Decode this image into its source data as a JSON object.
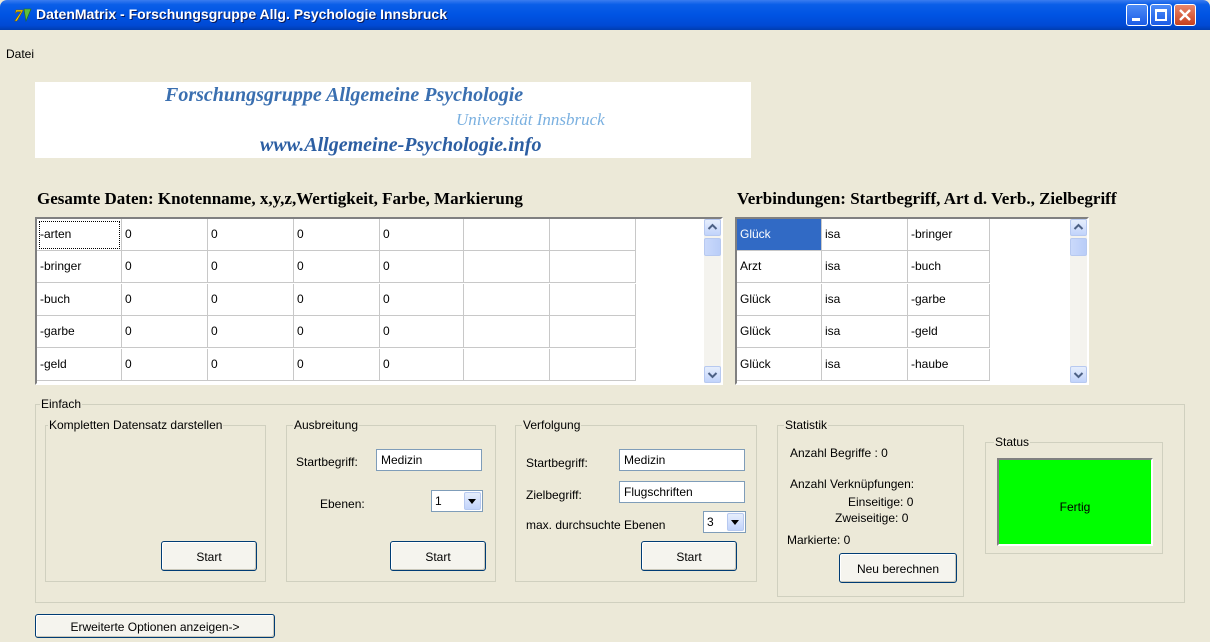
{
  "window": {
    "title": "DatenMatrix - Forschungsgruppe Allg. Psychologie Innsbruck"
  },
  "menu": {
    "file": "Datei"
  },
  "banner": {
    "line1": "Forschungsgruppe Allgemeine Psychologie",
    "line2": "Universität Innsbruck",
    "line3": "www.Allgemeine-Psychologie.info"
  },
  "data_grid": {
    "heading": "Gesamte Daten: Knotenname, x,y,z,Wertigkeit, Farbe, Markierung",
    "rows": [
      [
        "-arten",
        "0",
        "0",
        "0",
        "0",
        "",
        ""
      ],
      [
        "-bringer",
        "0",
        "0",
        "0",
        "0",
        "",
        ""
      ],
      [
        "-buch",
        "0",
        "0",
        "0",
        "0",
        "",
        ""
      ],
      [
        "-garbe",
        "0",
        "0",
        "0",
        "0",
        "",
        ""
      ],
      [
        "-geld",
        "0",
        "0",
        "0",
        "0",
        "",
        ""
      ]
    ]
  },
  "conn_grid": {
    "heading": "Verbindungen: Startbegriff, Art d. Verb., Zielbegriff",
    "rows": [
      [
        "Glück",
        "isa",
        "-bringer"
      ],
      [
        "Arzt",
        "isa",
        "-buch"
      ],
      [
        "Glück",
        "isa",
        "-garbe"
      ],
      [
        "Glück",
        "isa",
        "-geld"
      ],
      [
        "Glück",
        "isa",
        "-haube"
      ]
    ]
  },
  "einfach": {
    "label": "Einfach",
    "komplett": {
      "label": "Kompletten Datensatz darstellen",
      "start": "Start"
    },
    "ausbreitung": {
      "label": "Ausbreitung",
      "startbegriff_label": "Startbegriff:",
      "startbegriff_value": "Medizin",
      "ebenen_label": "Ebenen:",
      "ebenen_value": "1",
      "start": "Start"
    },
    "verfolgung": {
      "label": "Verfolgung",
      "startbegriff_label": "Startbegriff:",
      "startbegriff_value": "Medizin",
      "zielbegriff_label": "Zielbegriff:",
      "zielbegriff_value": "Flugschriften",
      "ebenen_label": "max. durchsuchte Ebenen",
      "ebenen_value": "3",
      "start": "Start"
    },
    "statistik": {
      "label": "Statistik",
      "begriffe": "Anzahl Begriffe :  0",
      "verknuepfungen": "Anzahl Verknüpfungen:",
      "einseitige": "Einseitige: 0",
      "zweiseitige": "Zweiseitige: 0",
      "markierte": "Markierte: 0",
      "recalc": "Neu berechnen"
    },
    "status": {
      "label": "Status",
      "value": "Fertig",
      "color": "#00ff00"
    }
  },
  "advanced_button": "Erweiterte Optionen anzeigen->"
}
